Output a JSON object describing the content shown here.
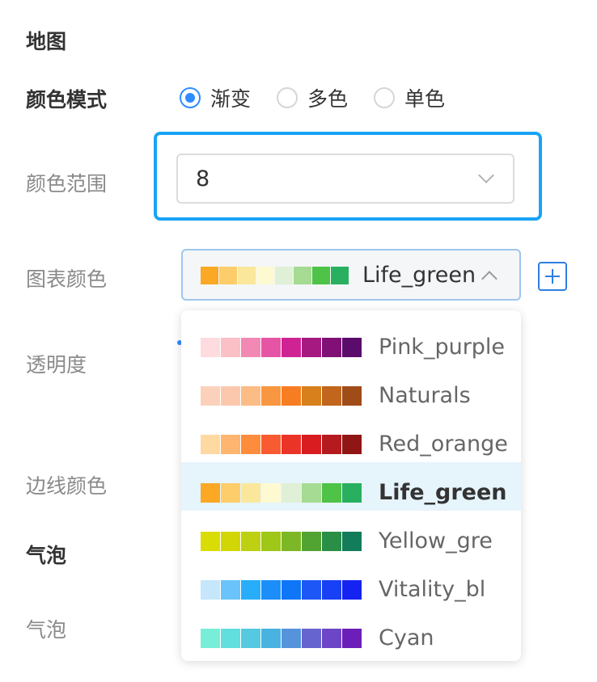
{
  "sections": {
    "map": "地图",
    "bubble": "气泡"
  },
  "labels": {
    "color_mode": "颜色模式",
    "color_range": "颜色范围",
    "chart_color": "图表颜色",
    "opacity": "透明度",
    "border_color": "边线颜色",
    "bubble": "气泡"
  },
  "color_mode": {
    "options": [
      "渐变",
      "多色",
      "单色"
    ],
    "selected": "渐变"
  },
  "color_range": {
    "value": "8"
  },
  "chart_color": {
    "selected": "Life_green",
    "selected_colors": [
      "#fba824",
      "#fdcd6b",
      "#fbe79c",
      "#fdf9d1",
      "#e0f0d6",
      "#a5db92",
      "#4ec348",
      "#28b060"
    ],
    "options": [
      {
        "label": "Pink_purple",
        "colors": [
          "#fddbde",
          "#fbbfc6",
          "#f288b4",
          "#e655a5",
          "#cf2394",
          "#a51980",
          "#800f76",
          "#5a0b6b"
        ]
      },
      {
        "label": "Naturals",
        "colors": [
          "#fcd1bc",
          "#fbc8ae",
          "#fcbc86",
          "#f99640",
          "#f77d23",
          "#d8801b",
          "#c2651d",
          "#9f4c19"
        ]
      },
      {
        "label": "Red_orange",
        "colors": [
          "#fed9a2",
          "#fdb56f",
          "#fd8c3d",
          "#f85a31",
          "#eb3428",
          "#d81c20",
          "#b41a1e",
          "#8f1614"
        ]
      },
      {
        "label": "Life_green",
        "colors": [
          "#fba824",
          "#fdcd6b",
          "#fbe79c",
          "#fdf9d1",
          "#e0f0d6",
          "#a5db92",
          "#4ec348",
          "#28b060"
        ]
      },
      {
        "label": "Yellow_gre",
        "colors": [
          "#dadc05",
          "#d2d607",
          "#bdd012",
          "#9ec717",
          "#7eb725",
          "#52a432",
          "#298f47",
          "#137c5b"
        ]
      },
      {
        "label": "Vitality_bl",
        "colors": [
          "#c6e6fc",
          "#6ac3fb",
          "#28adfb",
          "#1b8ef9",
          "#0e76f7",
          "#1d57f5",
          "#1840f4",
          "#1423f1"
        ]
      },
      {
        "label": "Cyan",
        "colors": [
          "#78eed8",
          "#61dfde",
          "#55c9df",
          "#49b2e0",
          "#5593db",
          "#6664cf",
          "#6d45c7",
          "#6c1eb8"
        ]
      }
    ]
  },
  "accent": "#2f8cff",
  "focus_color": "#1aa3f5"
}
